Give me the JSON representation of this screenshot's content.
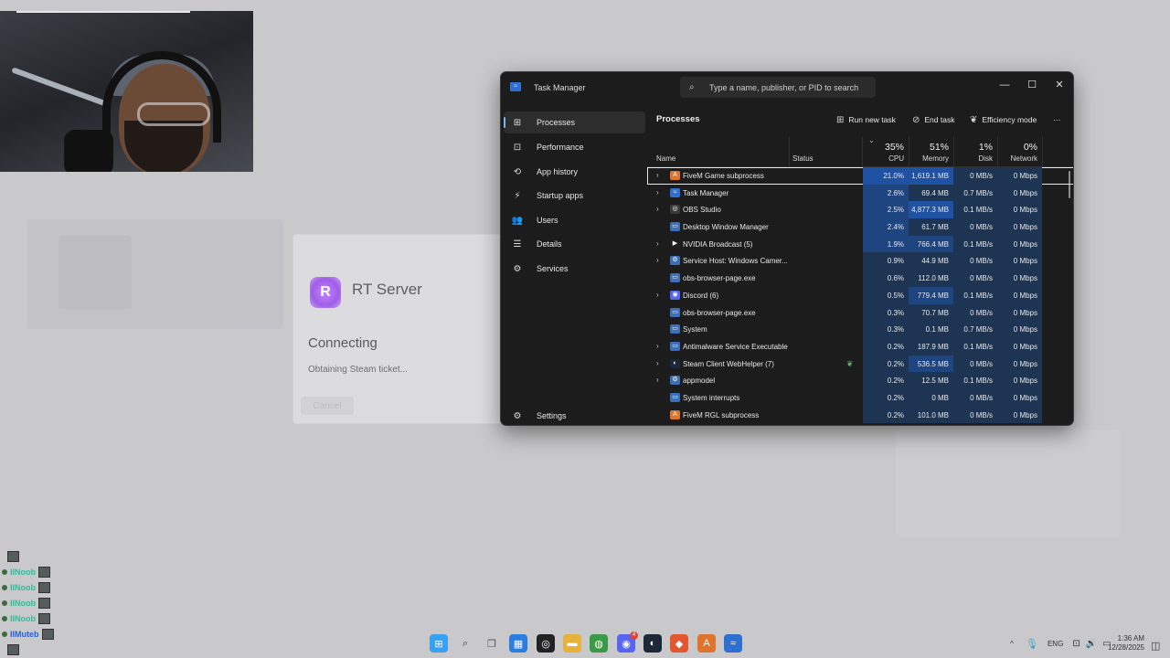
{
  "task_manager": {
    "title": "Task Manager",
    "search_placeholder": "Type a name, publisher, or PID to search",
    "window_controls": {
      "minimize": "—",
      "maximize": "☐",
      "close": "✕"
    },
    "sidebar": {
      "items": [
        {
          "label": "Processes",
          "icon": "processes-icon",
          "glyph": "⊞",
          "active": true
        },
        {
          "label": "Performance",
          "icon": "performance-icon",
          "glyph": "⊡"
        },
        {
          "label": "App history",
          "icon": "app-history-icon",
          "glyph": "⟲"
        },
        {
          "label": "Startup apps",
          "icon": "startup-apps-icon",
          "glyph": "⚡"
        },
        {
          "label": "Users",
          "icon": "users-icon",
          "glyph": "👥"
        },
        {
          "label": "Details",
          "icon": "details-icon",
          "glyph": "☰"
        },
        {
          "label": "Services",
          "icon": "services-icon",
          "glyph": "⚙"
        }
      ],
      "settings_label": "Settings"
    },
    "toolbar": {
      "heading": "Processes",
      "run_new_task": "Run new task",
      "end_task": "End task",
      "efficiency_mode": "Efficiency mode",
      "more": "···"
    },
    "columns": {
      "name": "Name",
      "status": "Status",
      "cpu": {
        "percent": "35%",
        "label": "CPU"
      },
      "memory": {
        "percent": "51%",
        "label": "Memory"
      },
      "disk": {
        "percent": "1%",
        "label": "Disk"
      },
      "network": {
        "percent": "0%",
        "label": "Network"
      }
    },
    "processes": [
      {
        "name": "FiveM Game subprocess",
        "expandable": true,
        "icon_color": "#e0742a",
        "icon_glyph": "A",
        "cpu": "21.0%",
        "memory": "1,619.1 MB",
        "disk": "0 MB/s",
        "network": "0 Mbps",
        "cpu_heat": 3,
        "mem_heat": 3,
        "selected": true
      },
      {
        "name": "Task Manager",
        "expandable": true,
        "icon_color": "#2f6fd1",
        "icon_glyph": "≈",
        "cpu": "2.6%",
        "memory": "69.4 MB",
        "disk": "0.7 MB/s",
        "network": "0 Mbps",
        "cpu_heat": 2,
        "mem_heat": 1
      },
      {
        "name": "OBS Studio",
        "expandable": true,
        "icon_color": "#3a3a3a",
        "icon_glyph": "◎",
        "cpu": "2.5%",
        "memory": "4,877.3 MB",
        "disk": "0.1 MB/s",
        "network": "0 Mbps",
        "cpu_heat": 2,
        "mem_heat": 3
      },
      {
        "name": "Desktop Window Manager",
        "expandable": false,
        "icon_color": "#3d6fb8",
        "icon_glyph": "▭",
        "cpu": "2.4%",
        "memory": "61.7 MB",
        "disk": "0 MB/s",
        "network": "0 Mbps",
        "cpu_heat": 2,
        "mem_heat": 1
      },
      {
        "name": "NVIDIA Broadcast (5)",
        "expandable": true,
        "icon_color": "#1f1f1f",
        "icon_glyph": "▶",
        "cpu": "1.9%",
        "memory": "766.4 MB",
        "disk": "0.1 MB/s",
        "network": "0 Mbps",
        "cpu_heat": 2,
        "mem_heat": 2
      },
      {
        "name": "Service Host: Windows Camer...",
        "expandable": true,
        "icon_color": "#3d6fb8",
        "icon_glyph": "⚙",
        "cpu": "0.9%",
        "memory": "44.9 MB",
        "disk": "0 MB/s",
        "network": "0 Mbps",
        "cpu_heat": 1,
        "mem_heat": 1
      },
      {
        "name": "obs-browser-page.exe",
        "expandable": false,
        "icon_color": "#3d6fb8",
        "icon_glyph": "▭",
        "cpu": "0.6%",
        "memory": "112.0 MB",
        "disk": "0 MB/s",
        "network": "0 Mbps",
        "cpu_heat": 1,
        "mem_heat": 1
      },
      {
        "name": "Discord (6)",
        "expandable": true,
        "icon_color": "#5865f2",
        "icon_glyph": "◉",
        "cpu": "0.5%",
        "memory": "779.4 MB",
        "disk": "0.1 MB/s",
        "network": "0 Mbps",
        "cpu_heat": 1,
        "mem_heat": 2
      },
      {
        "name": "obs-browser-page.exe",
        "expandable": false,
        "icon_color": "#3d6fb8",
        "icon_glyph": "▭",
        "cpu": "0.3%",
        "memory": "70.7 MB",
        "disk": "0 MB/s",
        "network": "0 Mbps",
        "cpu_heat": 1,
        "mem_heat": 1
      },
      {
        "name": "System",
        "expandable": false,
        "icon_color": "#3d6fb8",
        "icon_glyph": "▭",
        "cpu": "0.3%",
        "memory": "0.1 MB",
        "disk": "0.7 MB/s",
        "network": "0 Mbps",
        "cpu_heat": 1,
        "mem_heat": 1
      },
      {
        "name": "Antimalware Service Executable",
        "expandable": true,
        "icon_color": "#3d6fb8",
        "icon_glyph": "▭",
        "cpu": "0.2%",
        "memory": "187.9 MB",
        "disk": "0.1 MB/s",
        "network": "0 Mbps",
        "cpu_heat": 1,
        "mem_heat": 1
      },
      {
        "name": "Steam Client WebHelper (7)",
        "expandable": true,
        "icon_color": "#1b2838",
        "icon_glyph": "◐",
        "cpu": "0.2%",
        "memory": "536.5 MB",
        "disk": "0 MB/s",
        "network": "0 Mbps",
        "cpu_heat": 1,
        "mem_heat": 2,
        "efficiency_leaf": true
      },
      {
        "name": "appmodel",
        "expandable": true,
        "icon_color": "#3d6fb8",
        "icon_glyph": "⚙",
        "cpu": "0.2%",
        "memory": "12.5 MB",
        "disk": "0.1 MB/s",
        "network": "0 Mbps",
        "cpu_heat": 1,
        "mem_heat": 1
      },
      {
        "name": "System interrupts",
        "expandable": false,
        "icon_color": "#3d6fb8",
        "icon_glyph": "▭",
        "cpu": "0.2%",
        "memory": "0 MB",
        "disk": "0 MB/s",
        "network": "0 Mbps",
        "cpu_heat": 1,
        "mem_heat": 1
      },
      {
        "name": "FiveM RGL subprocess",
        "expandable": false,
        "icon_color": "#e0742a",
        "icon_glyph": "A",
        "cpu": "0.2%",
        "memory": "101.0 MB",
        "disk": "0 MB/s",
        "network": "0 Mbps",
        "cpu_heat": 1,
        "mem_heat": 1
      }
    ]
  },
  "rt_server_dialog": {
    "logo_glyph": "R",
    "title": "RT Server",
    "status": "Connecting",
    "substatus": "Obtaining Steam ticket...",
    "cancel": "Cancel"
  },
  "chat_overlay": [
    {
      "name": "IINoob",
      "style": "teal"
    },
    {
      "name": "IINoob",
      "style": "teal"
    },
    {
      "name": "IINoob",
      "style": "teal"
    },
    {
      "name": "IINoob",
      "style": "teal"
    },
    {
      "name": "IIMuteb",
      "style": "blue"
    }
  ],
  "taskbar": {
    "apps": [
      {
        "name": "start-icon",
        "glyph": "⊞",
        "color": "#3aa0f0"
      },
      {
        "name": "search-icon",
        "glyph": "⌕",
        "color": "#444"
      },
      {
        "name": "task-view-icon",
        "glyph": "❐",
        "color": "#555"
      },
      {
        "name": "store-icon",
        "glyph": "▦",
        "color": "#2b7de0"
      },
      {
        "name": "obs-icon",
        "glyph": "◎",
        "color": "#222"
      },
      {
        "name": "file-explorer-icon",
        "glyph": "▬",
        "color": "#e8b23a"
      },
      {
        "name": "chrome-icon",
        "glyph": "◍",
        "color": "#3b9a48"
      },
      {
        "name": "discord-icon",
        "glyph": "◉",
        "color": "#5865f2"
      },
      {
        "name": "steam-icon",
        "glyph": "◐",
        "color": "#1b2838"
      },
      {
        "name": "brave-icon",
        "glyph": "◆",
        "color": "#e4572e"
      },
      {
        "name": "fivem-icon",
        "glyph": "A",
        "color": "#e0742a"
      },
      {
        "name": "task-manager-icon",
        "glyph": "≈",
        "color": "#2f6fd1"
      }
    ],
    "discord_badge": "4",
    "tray": {
      "chevron": "^",
      "language": "ENG"
    },
    "clock": {
      "time": "1:36 AM",
      "date": "12/28/2025"
    }
  }
}
